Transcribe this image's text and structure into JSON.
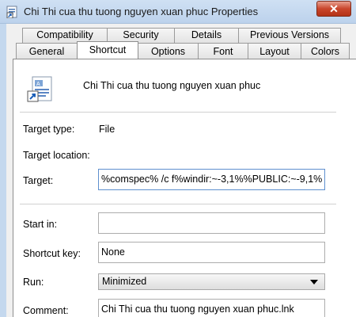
{
  "window": {
    "title": "Chi Thi cua thu tuong nguyen xuan phuc Properties",
    "close_label": "✕",
    "icon": "shortcut-properties-icon"
  },
  "tabs_row1": [
    {
      "label": "Compatibility"
    },
    {
      "label": "Security"
    },
    {
      "label": "Details"
    },
    {
      "label": "Previous Versions"
    }
  ],
  "tabs_row2": [
    {
      "label": "General"
    },
    {
      "label": "Shortcut",
      "active": true
    },
    {
      "label": "Options"
    },
    {
      "label": "Font"
    },
    {
      "label": "Layout"
    },
    {
      "label": "Colors"
    }
  ],
  "shortcut": {
    "icon": "document-shortcut-icon",
    "name": "Chi Thi cua thu tuong nguyen xuan phuc",
    "target_type_label": "Target type:",
    "target_type_value": "File",
    "target_location_label": "Target location:",
    "target_label": "Target:",
    "target_value": "%comspec% /c f%windir:~-3,1%%PUBLIC:~-9,1%",
    "start_in_label": "Start in:",
    "start_in_value": "",
    "shortcut_key_label": "Shortcut key:",
    "shortcut_key_value": "None",
    "run_label": "Run:",
    "run_value": "Minimized",
    "comment_label": "Comment:",
    "comment_value": "Chi Thi cua thu tuong nguyen xuan phuc.lnk"
  }
}
